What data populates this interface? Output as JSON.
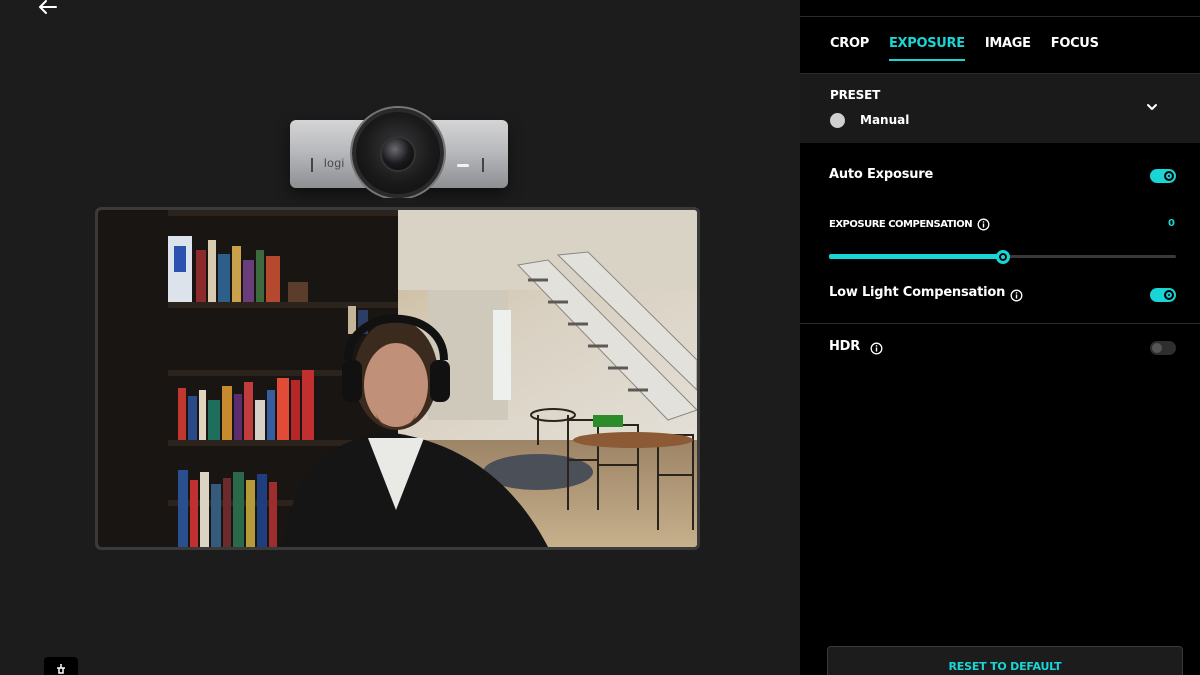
{
  "nav": {
    "back_icon": "arrow-left-icon"
  },
  "webcam": {
    "logo_text": "logi"
  },
  "tabs": [
    {
      "label": "CROP",
      "active": false
    },
    {
      "label": "EXPOSURE",
      "active": true
    },
    {
      "label": "IMAGE",
      "active": false
    },
    {
      "label": "FOCUS",
      "active": false
    }
  ],
  "preset": {
    "title": "PRESET",
    "value": "Manual",
    "icon": "chevron-down-icon"
  },
  "auto_exposure": {
    "label": "Auto Exposure",
    "enabled": true
  },
  "exposure_compensation": {
    "label": "EXPOSURE COMPENSATION",
    "value": "0",
    "level_fraction": 0.5
  },
  "low_light": {
    "label": "Low Light Compensation",
    "enabled": true
  },
  "hdr": {
    "label": "HDR",
    "enabled": false
  },
  "reset": {
    "label": "RESET TO DEFAULT"
  },
  "colors": {
    "accent": "#1ad5d5",
    "panel_bg": "#000000",
    "page_bg": "#1c1c1c"
  }
}
